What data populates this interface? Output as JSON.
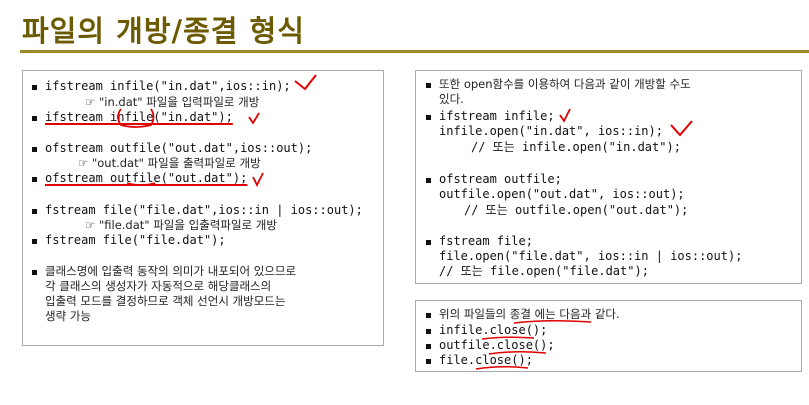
{
  "title": "파일의 개방/종결 형식",
  "left": {
    "l1": "ifstream infile(\"in.dat\",ios::in);",
    "l2": "☞ \"in.dat\" 파일을 입력파일로 개방",
    "l3": "ifstream infile(\"in.dat\");",
    "l4": "ofstream outfile(\"out.dat\",ios::out);",
    "l5": "☞ \"out.dat\" 파일을 출력파일로 개방",
    "l6": "ofstream outfile(\"out.dat\");",
    "l7": "fstream file(\"file.dat\",ios::in | ios::out);",
    "l8": "☞ \"file.dat\" 파일을 입출력파일로 개방",
    "l9": "fstream file(\"file.dat\");",
    "l10": "클래스명에 입출력 동작의 의미가 내포되어 있으므로",
    "l11": "각 클래스의 생성자가 자동적으로 해당클래스의",
    "l12": "입출력 모드를 결정하므로 객체 선언시 개방모드는",
    "l13": "생략 가능"
  },
  "right_top": {
    "r1": "또한 open함수를 이용하여 다음과 같이 개방할 수도",
    "r2": "있다.",
    "r3": "ifstream infile;",
    "r4": "infile.open(\"in.dat\", ios::in);",
    "r5": "// 또는 infile.open(\"in.dat\");",
    "r6": "ofstream outfile;",
    "r7": "outfile.open(\"out.dat\", ios::out);",
    "r8": "// 또는 outfile.open(\"out.dat\");",
    "r9": "fstream file;",
    "r10": "file.open(\"file.dat\", ios::in | ios::out);",
    "r11": "// 또는 file.open(\"file.dat\");"
  },
  "right_bottom": {
    "b1": "위의 파일들의 종결 에는 다음과 같다.",
    "b2": "infile.close();",
    "b3": "outfile.close();",
    "b4": "file.close();"
  },
  "colors": {
    "title": "#6b5a00",
    "rule": "#9a8a2a",
    "annotation": "#e00000"
  }
}
